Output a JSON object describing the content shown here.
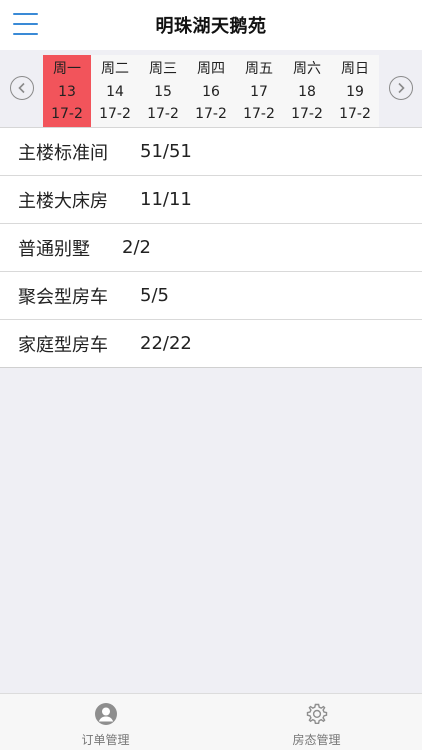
{
  "header": {
    "title": "明珠湖天鹅苑"
  },
  "calendar": {
    "prev_icon": "chevron-left-circle-icon",
    "next_icon": "chevron-right-circle-icon",
    "days": [
      {
        "weekday": "周一",
        "date": "13",
        "status": "17-2",
        "selected": true
      },
      {
        "weekday": "周二",
        "date": "14",
        "status": "17-2",
        "selected": false
      },
      {
        "weekday": "周三",
        "date": "15",
        "status": "17-2",
        "selected": false
      },
      {
        "weekday": "周四",
        "date": "16",
        "status": "17-2",
        "selected": false
      },
      {
        "weekday": "周五",
        "date": "17",
        "status": "17-2",
        "selected": false
      },
      {
        "weekday": "周六",
        "date": "18",
        "status": "17-2",
        "selected": false
      },
      {
        "weekday": "周日",
        "date": "19",
        "status": "17-2",
        "selected": false
      }
    ],
    "selected_color": "#f2545b"
  },
  "rooms": [
    {
      "name": "主楼标准间",
      "count": "51/51"
    },
    {
      "name": "主楼大床房",
      "count": "11/11"
    },
    {
      "name": "普通别墅",
      "count": "2/2"
    },
    {
      "name": "聚会型房车",
      "count": "5/5"
    },
    {
      "name": "家庭型房车",
      "count": "22/22"
    }
  ],
  "tabbar": {
    "tabs": [
      {
        "label": "订单管理",
        "icon": "person-icon"
      },
      {
        "label": "房态管理",
        "icon": "gear-icon"
      }
    ]
  },
  "colors": {
    "accent": "#3a8ad6",
    "background": "#efeff4"
  }
}
